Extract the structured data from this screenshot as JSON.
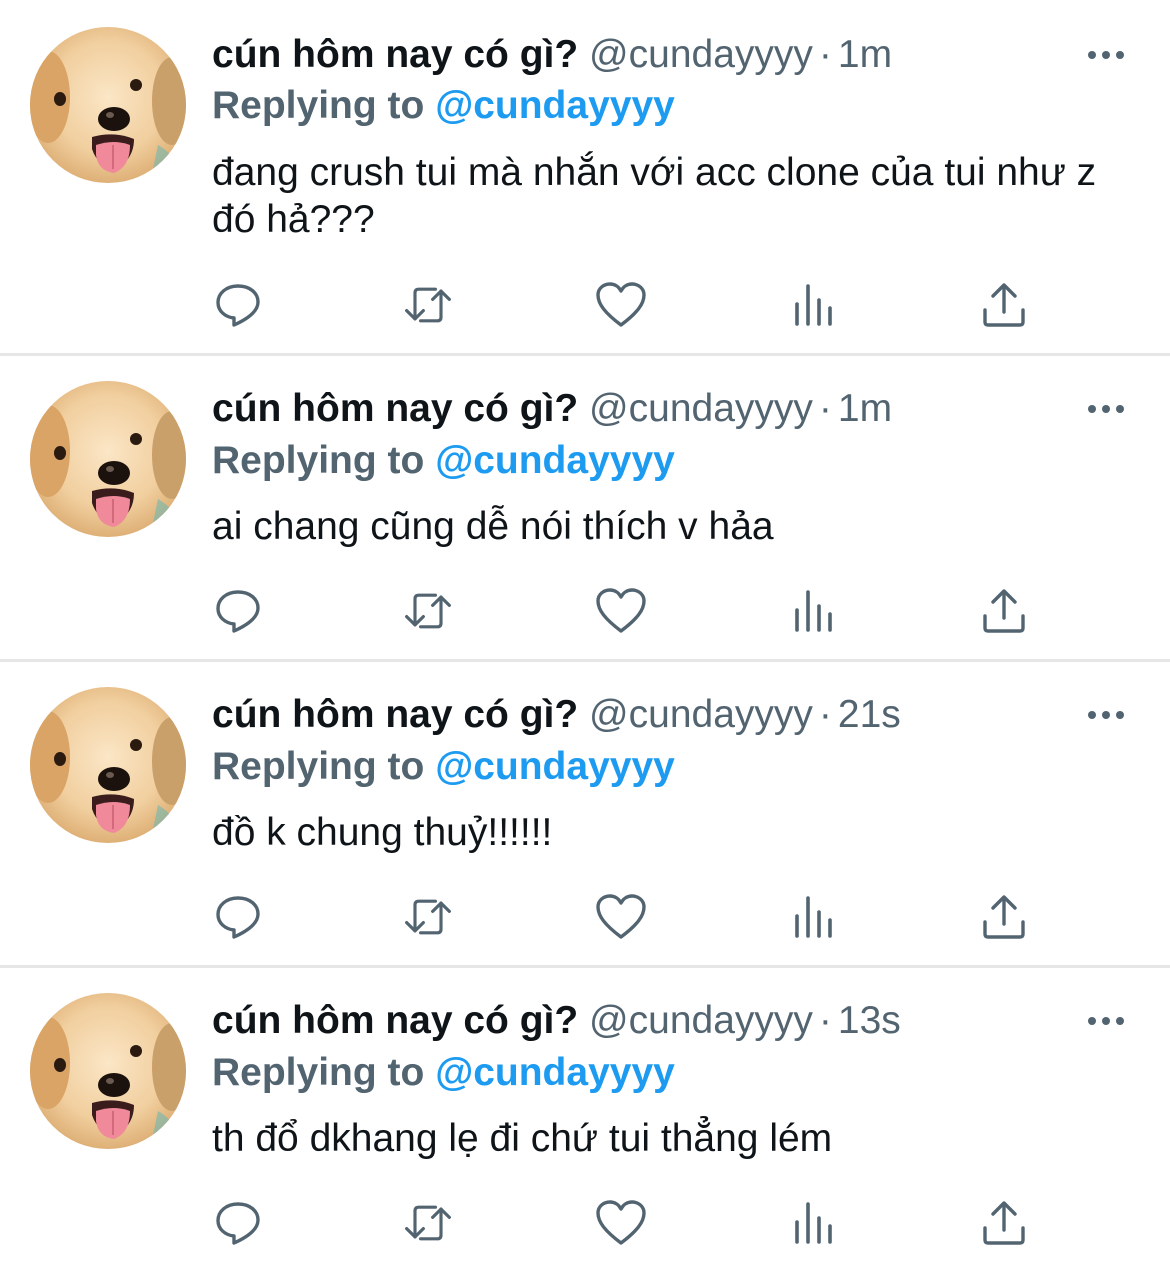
{
  "colors": {
    "text": "#0f1419",
    "muted": "#536471",
    "link": "#1d9bf0",
    "divider": "#e6e6e6"
  },
  "icons": [
    "reply-icon",
    "retweet-icon",
    "like-icon",
    "analytics-icon",
    "share-icon",
    "more-icon"
  ],
  "tweets": [
    {
      "name": "cún hôm nay có gì?",
      "handle": "@cundayyyy",
      "separator": "·",
      "time": "1m",
      "replying_label": "Replying to",
      "replying_handle": "@cundayyyy",
      "text": "đang crush tui mà nhắn với acc clone của tui như z đó hả???"
    },
    {
      "name": "cún hôm nay có gì?",
      "handle": "@cundayyyy",
      "separator": "·",
      "time": "1m",
      "replying_label": "Replying to",
      "replying_handle": "@cundayyyy",
      "text": "ai chang cũng dễ nói thích v hảa"
    },
    {
      "name": "cún hôm nay có gì?",
      "handle": "@cundayyyy",
      "separator": "·",
      "time": "21s",
      "replying_label": "Replying to",
      "replying_handle": "@cundayyyy",
      "text": "đồ k chung thuỷ!!!!!!"
    },
    {
      "name": "cún hôm nay có gì?",
      "handle": "@cundayyyy",
      "separator": "·",
      "time": "13s",
      "replying_label": "Replying to",
      "replying_handle": "@cundayyyy",
      "text": "th đổ dkhang lẹ đi chứ tui thẳng lém"
    }
  ]
}
